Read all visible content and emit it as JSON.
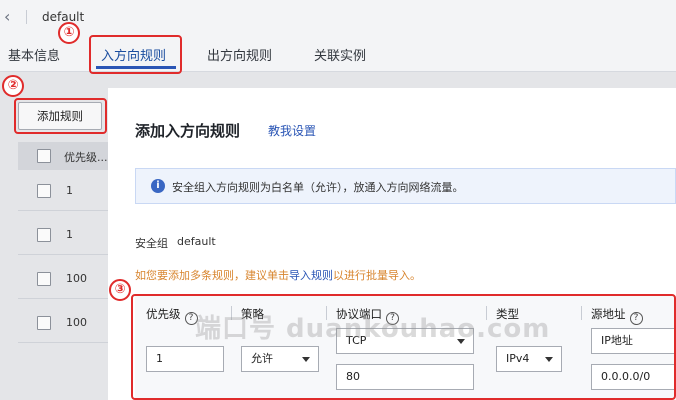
{
  "header": {
    "back_icon": "chevron-left-icon",
    "title": "default"
  },
  "tabs": [
    {
      "label": "基本信息"
    },
    {
      "label": "入方向规则"
    },
    {
      "label": "出方向规则"
    },
    {
      "label": "关联实例"
    }
  ],
  "toolbar": {
    "add_rule_label": "添加规则"
  },
  "table": {
    "header_priority": "优先级...",
    "rows": [
      {
        "priority": "1"
      },
      {
        "priority": "1"
      },
      {
        "priority": "100"
      },
      {
        "priority": "100"
      }
    ]
  },
  "annotations": {
    "one": "①",
    "two": "②",
    "three": "③",
    "color": "#e02b2b"
  },
  "modal": {
    "title": "添加入方向规则",
    "help_link": "教我设置",
    "info_text": "安全组入方向规则为白名单（允许），放通入方向网络流量。",
    "sg_label": "安全组",
    "sg_value": "default",
    "hint_prefix": "如您要添加多条规则，建议单击",
    "hint_link": "导入规则",
    "hint_suffix": "以进行批量导入。",
    "columns": {
      "priority": "优先级",
      "policy": "策略",
      "protocol_port": "协议端口",
      "type": "类型",
      "source": "源地址"
    },
    "row": {
      "priority_value": "1",
      "policy_value": "允许",
      "protocol_value": "TCP",
      "port_value": "80",
      "type_value": "IPv4",
      "source_type_value": "IP地址",
      "source_value": "0.0.0.0/0"
    }
  },
  "watermark": "端口号 duankouhao.com",
  "colors": {
    "accent": "#2a55b5",
    "annotation": "#e02b2b",
    "hint": "#d8852e"
  }
}
